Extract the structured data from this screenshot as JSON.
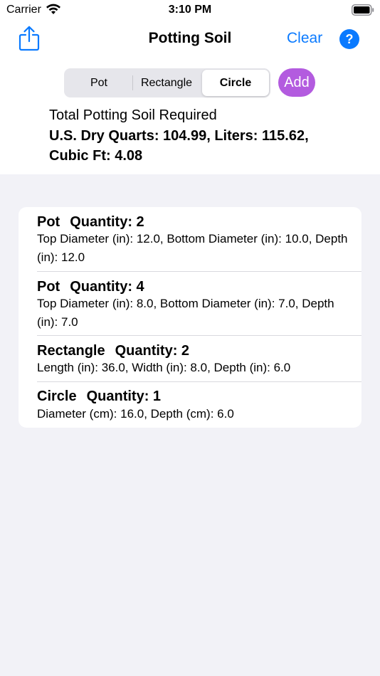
{
  "status_bar": {
    "carrier": "Carrier",
    "time": "3:10 PM"
  },
  "nav": {
    "title": "Potting Soil",
    "clear_label": "Clear",
    "help_label": "?"
  },
  "segments": [
    "Pot",
    "Rectangle",
    "Circle"
  ],
  "selected_segment": "Circle",
  "add_label": "Add",
  "totals": {
    "heading": "Total Potting Soil Required",
    "values": "U.S. Dry Quarts: 104.99, Liters: 115.62, Cubic Ft: 4.08"
  },
  "items": [
    {
      "type": "Pot",
      "quantity": "Quantity: 2",
      "details": "Top Diameter (in): 12.0, Bottom Diameter (in): 10.0, Depth (in): 12.0"
    },
    {
      "type": "Pot",
      "quantity": "Quantity: 4",
      "details": "Top Diameter (in): 8.0, Bottom Diameter (in): 7.0, Depth (in): 7.0"
    },
    {
      "type": "Rectangle",
      "quantity": "Quantity: 2",
      "details": "Length (in): 36.0, Width (in): 8.0, Depth (in): 6.0"
    },
    {
      "type": "Circle",
      "quantity": "Quantity: 1",
      "details": "Diameter (cm): 16.0, Depth (cm): 6.0"
    }
  ],
  "colors": {
    "accent": "#0a7aff",
    "add_button": "#b35bdf",
    "background": "#f2f2f7"
  }
}
